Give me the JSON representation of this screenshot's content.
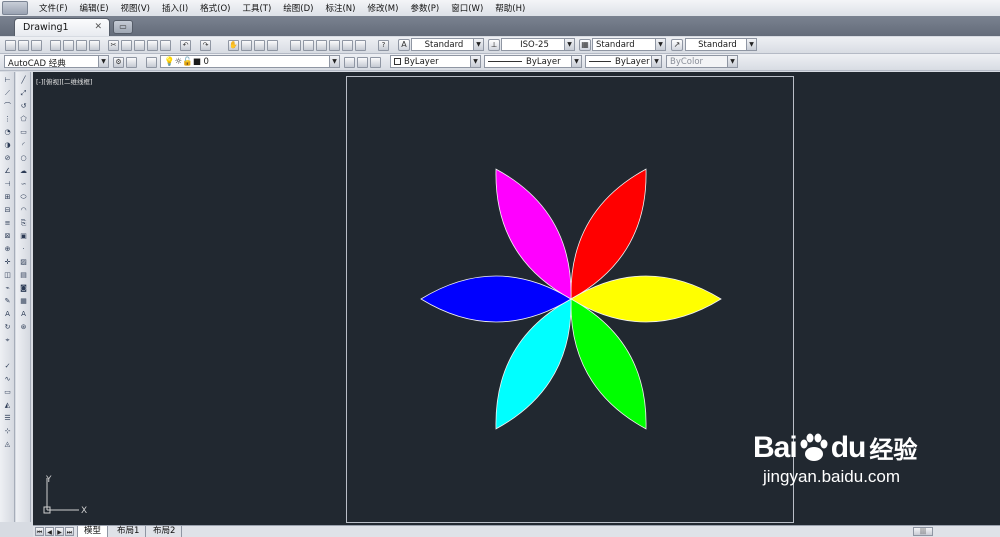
{
  "menu": [
    "文件(F)",
    "编辑(E)",
    "视图(V)",
    "插入(I)",
    "格式(O)",
    "工具(T)",
    "绘图(D)",
    "标注(N)",
    "修改(M)",
    "参数(P)",
    "窗口(W)",
    "帮助(H)"
  ],
  "doc_tab": {
    "title": "Drawing1",
    "close": "✕"
  },
  "styles_toolbar": {
    "text_style": "Standard",
    "dim_style": "ISO-25",
    "table_style": "Standard",
    "multileader_style": "Standard"
  },
  "workspace": "AutoCAD 经典",
  "layer": "0",
  "properties": {
    "color": "ByLayer",
    "linetype": "ByLayer",
    "lineweight": "ByLayer",
    "plotstyle": "ByColor"
  },
  "viewport_label": "[-][俯视][二维线框]",
  "ucs": {
    "x": "X",
    "y": "Y"
  },
  "layout_tabs": [
    "模型",
    "布局1",
    "布局2"
  ],
  "watermark": {
    "brand": "Bai",
    "brand2": "du",
    "cn": "经验",
    "url": "jingyan.baidu.com"
  },
  "petal_colors": [
    "#ff0000",
    "#ffff00",
    "#00ff00",
    "#00ffff",
    "#0000ff",
    "#ff00ff"
  ],
  "petal_angles_deg": [
    60,
    0,
    -60,
    -120,
    180,
    120
  ]
}
